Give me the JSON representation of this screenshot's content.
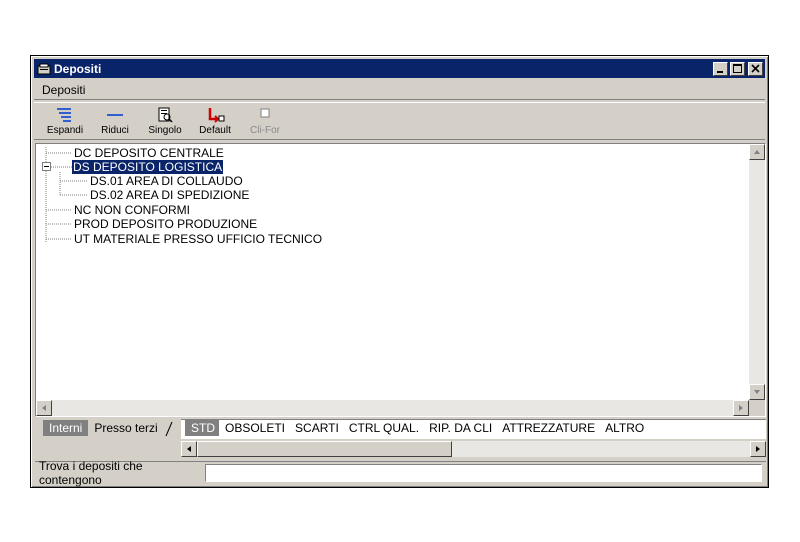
{
  "window": {
    "title": "Depositi"
  },
  "menu": {
    "items": [
      "Depositi"
    ]
  },
  "toolbar": {
    "buttons": [
      {
        "label": "Espandi",
        "icon": "expand-icon",
        "enabled": true
      },
      {
        "label": "Riduci",
        "icon": "collapse-icon",
        "enabled": true
      },
      {
        "label": "Singolo",
        "icon": "single-icon",
        "enabled": true
      },
      {
        "label": "Default",
        "icon": "default-icon",
        "enabled": true
      },
      {
        "label": "Cli-For",
        "icon": "checkbox-icon",
        "enabled": false
      }
    ]
  },
  "tree": {
    "nodes": [
      {
        "text": "DC  DEPOSITO CENTRALE",
        "level": 0,
        "selected": false
      },
      {
        "text": "DS  DEPOSITO LOGISTICA",
        "level": 0,
        "selected": true,
        "expanded": true
      },
      {
        "text": "DS.01  AREA DI COLLAUDO",
        "level": 1,
        "selected": false
      },
      {
        "text": "DS.02  AREA DI SPEDIZIONE",
        "level": 1,
        "selected": false
      },
      {
        "text": "NC  NON CONFORMI",
        "level": 0,
        "selected": false
      },
      {
        "text": "PROD  DEPOSITO PRODUZIONE",
        "level": 0,
        "selected": false
      },
      {
        "text": "UT  MATERIALE PRESSO UFFICIO TECNICO",
        "level": 0,
        "selected": false
      }
    ]
  },
  "tabs_left": [
    "Interni",
    "Presso terzi"
  ],
  "tabs_left_active": "Interni",
  "tabs_right": [
    "STD",
    "OBSOLETI",
    "SCARTI",
    "CTRL QUAL.",
    "RIP. DA  CLI",
    "ATTREZZATURE",
    "ALTRO"
  ],
  "tabs_right_active": "STD",
  "find": {
    "label": "Trova i depositi che contengono",
    "value": ""
  },
  "colors": {
    "titlebar": "#0a246a",
    "face": "#d4d0c8",
    "selection": "#0a246a"
  }
}
